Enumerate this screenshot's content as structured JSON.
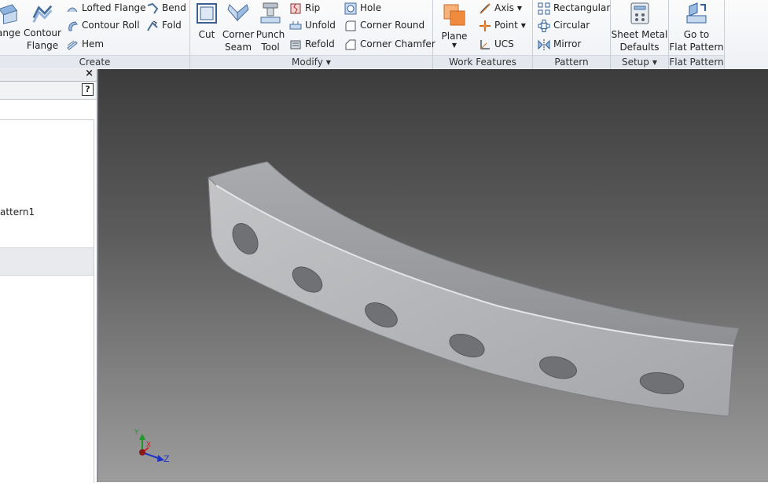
{
  "ribbon": {
    "create": {
      "label": "Create",
      "flange_partial": "ange",
      "contour_flange_line1": "Contour",
      "contour_flange_line2": "Flange",
      "lofted_flange": "Lofted Flange",
      "contour_roll": "Contour Roll",
      "hem": "Hem",
      "bend": "Bend",
      "fold": "Fold"
    },
    "modify": {
      "label": "Modify",
      "cut": "Cut",
      "corner_seam_line1": "Corner",
      "corner_seam_line2": "Seam",
      "punch_tool_line1": "Punch",
      "punch_tool_line2": "Tool",
      "rip": "Rip",
      "unfold": "Unfold",
      "refold": "Refold",
      "hole": "Hole",
      "corner_round": "Corner Round",
      "corner_chamfer": "Corner Chamfer"
    },
    "work_features": {
      "label": "Work Features",
      "plane": "Plane",
      "axis": "Axis",
      "point": "Point",
      "ucs": "UCS"
    },
    "pattern": {
      "label": "Pattern",
      "rectangular": "Rectangular",
      "circular": "Circular",
      "mirror": "Mirror"
    },
    "setup": {
      "label": "Setup",
      "sheet_metal_defaults_line1": "Sheet Metal",
      "sheet_metal_defaults_line2": "Defaults"
    },
    "flat_pattern": {
      "label": "Flat Pattern",
      "go_to_line1": "Go to",
      "go_to_line2": "Flat Pattern"
    }
  },
  "browser": {
    "close_glyph": "×",
    "help_glyph": "?",
    "tree_item_partial": "attern1"
  },
  "viewport": {
    "triad": {
      "x_label": "X",
      "y_label": "Y",
      "z_label": "Z"
    }
  },
  "colors": {
    "ribbon_bg": "#eef1f5",
    "viewport_top": "#3c3c3c",
    "viewport_bottom": "#9d9d9d",
    "part_surface": "#aeb0b3",
    "axis_x": "#d22020",
    "axis_y": "#1e9a2c",
    "axis_z": "#2033c8"
  }
}
